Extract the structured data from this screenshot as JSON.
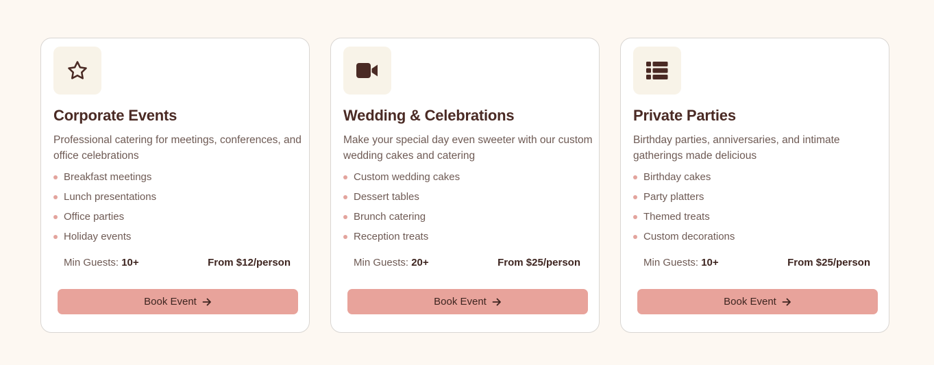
{
  "colors": {
    "page_background": "#fdf8f2",
    "card_background": "#ffffff",
    "icon_background": "#f8f3e8",
    "accent": "#e8a39b",
    "bullet": "#e3a49d",
    "heading_text": "#4a2a24",
    "body_text": "#6e5a54"
  },
  "cards": [
    {
      "icon": "star-icon",
      "title": "Corporate Events",
      "description": "Professional catering for meetings, conferences, and office celebrations",
      "features": [
        "Breakfast meetings",
        "Lunch presentations",
        "Office parties",
        "Holiday events"
      ],
      "min_guests_label": "Min Guests:",
      "min_guests_value": "10+",
      "price": "From $12/person",
      "button_label": "Book Event",
      "button_icon": "arrow-right-icon"
    },
    {
      "icon": "video-camera-icon",
      "title": "Wedding & Celebrations",
      "description": "Make your special day even sweeter with our custom wedding cakes and catering",
      "features": [
        "Custom wedding cakes",
        "Dessert tables",
        "Brunch catering",
        "Reception treats"
      ],
      "min_guests_label": "Min Guests:",
      "min_guests_value": "20+",
      "price": "From $25/person",
      "button_label": "Book Event",
      "button_icon": "arrow-right-icon"
    },
    {
      "icon": "list-icon",
      "title": "Private Parties",
      "description": "Birthday parties, anniversaries, and intimate gatherings made delicious",
      "features": [
        "Birthday cakes",
        "Party platters",
        "Themed treats",
        "Custom decorations"
      ],
      "min_guests_label": "Min Guests:",
      "min_guests_value": "10+",
      "price": "From $25/person",
      "button_label": "Book Event",
      "button_icon": "arrow-right-icon"
    }
  ]
}
